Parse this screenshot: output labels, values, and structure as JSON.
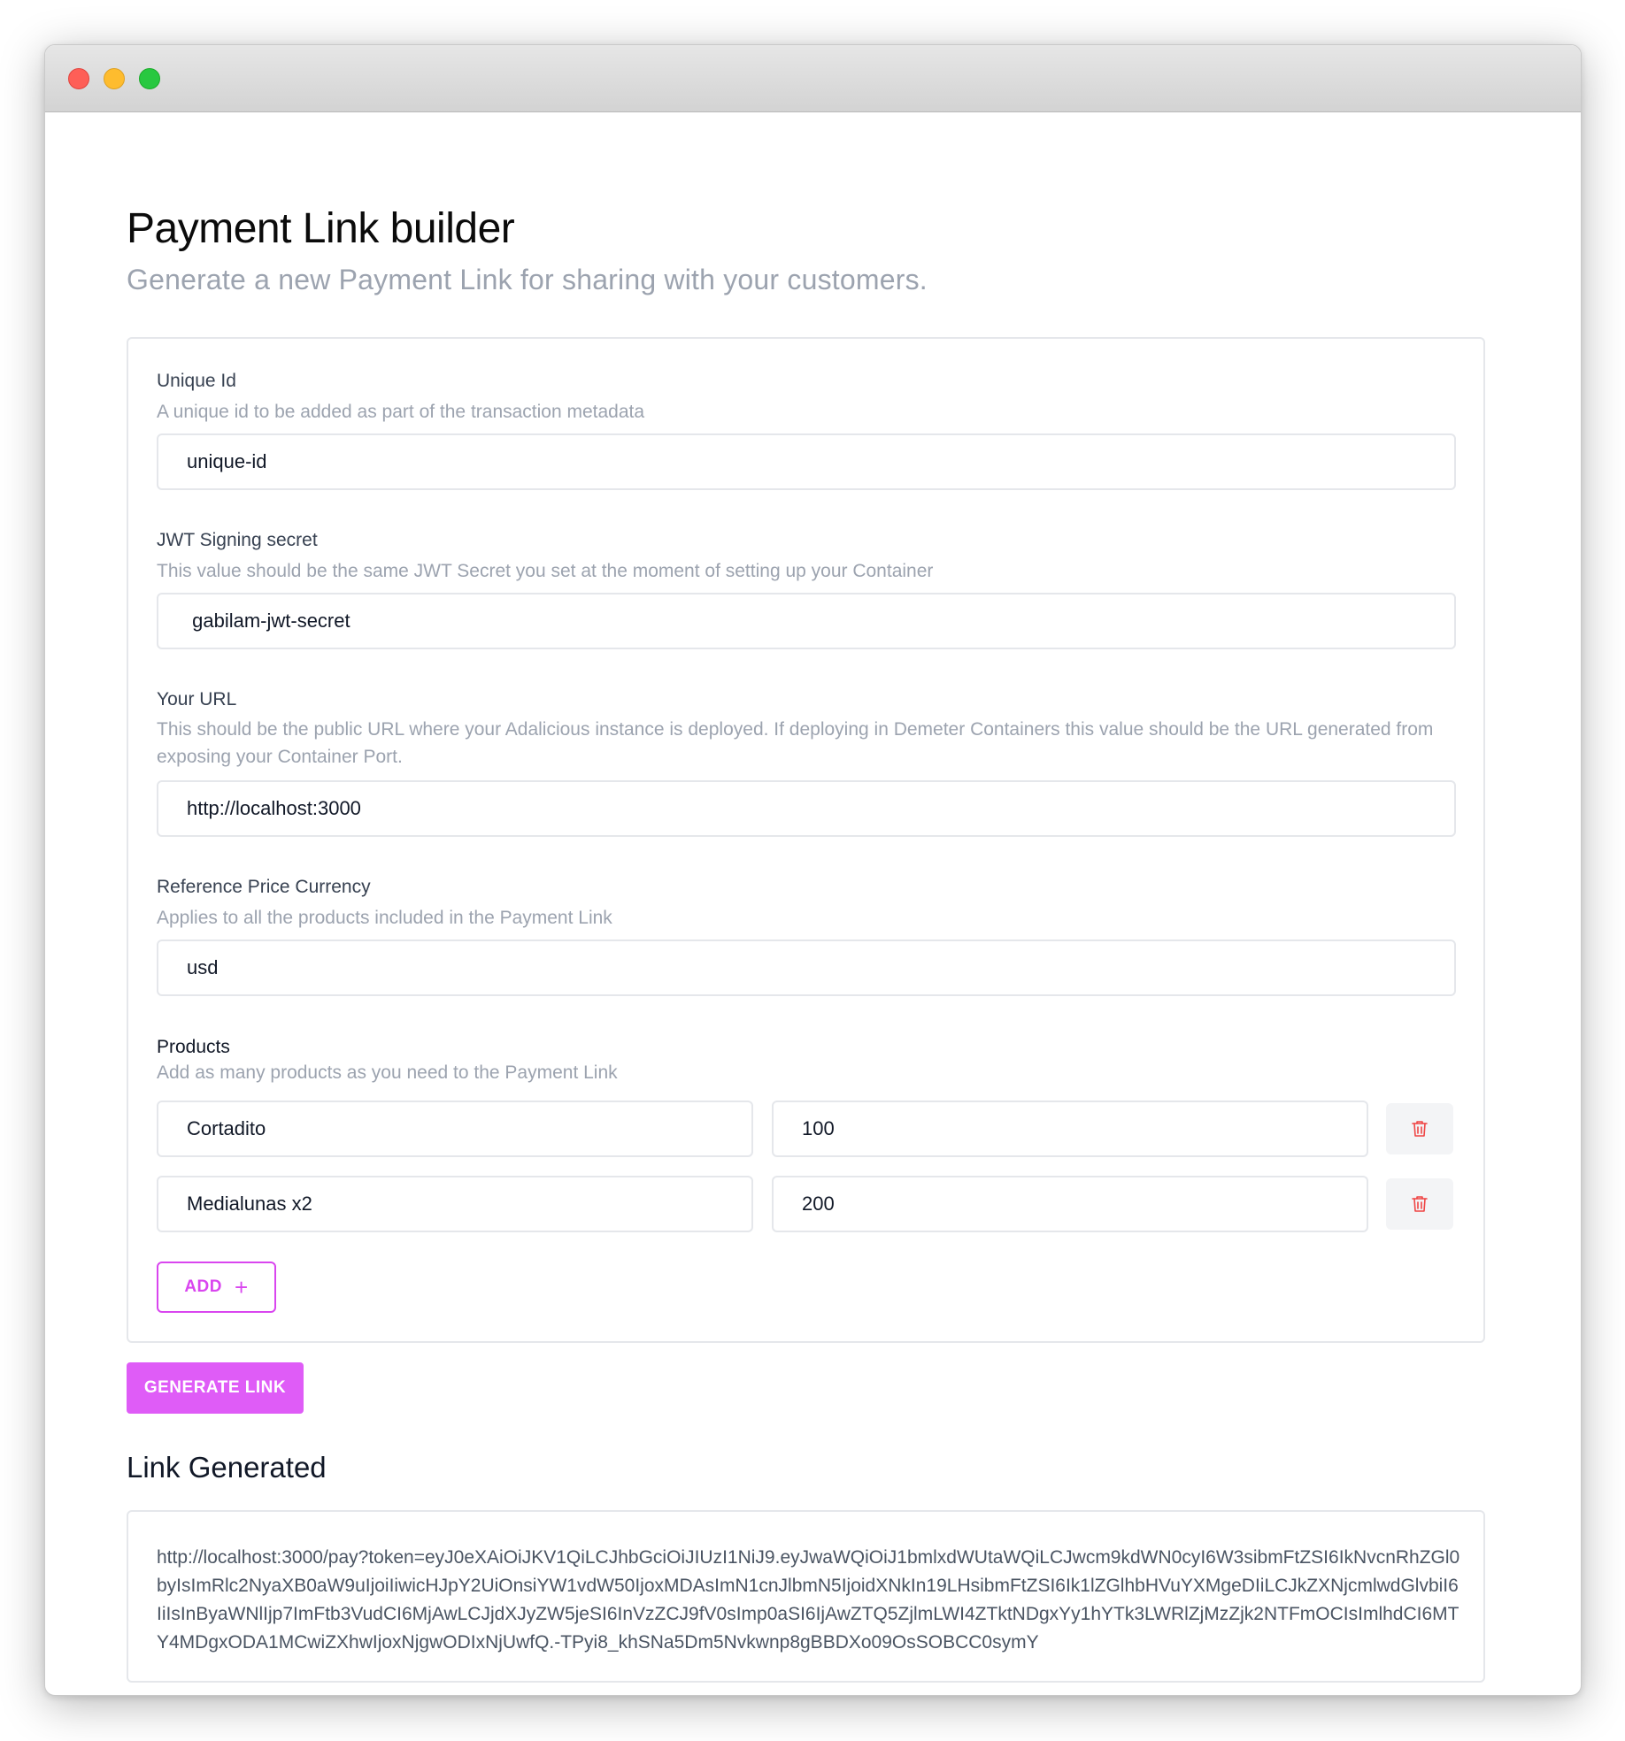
{
  "page": {
    "title": "Payment Link builder",
    "subtitle": "Generate a new Payment Link for sharing with your customers."
  },
  "fields": {
    "unique_id": {
      "label": "Unique Id",
      "help": "A unique id to be added as part of the transaction metadata",
      "value": "unique-id"
    },
    "jwt_secret": {
      "label": "JWT Signing secret",
      "help": "This value should be the same JWT Secret you set at the moment of setting up your Container",
      "value": " gabilam-jwt-secret"
    },
    "url": {
      "label": "Your URL",
      "help": "This should be the public URL where your Adalicious instance is deployed. If deploying in Demeter Containers this value should be the URL generated from exposing your Container Port.",
      "value": "http://localhost:3000"
    },
    "currency": {
      "label": "Reference Price Currency",
      "help": "Applies to all the products included in the Payment Link",
      "value": "usd"
    }
  },
  "products": {
    "label": "Products",
    "help": "Add as many products as you need to the Payment Link",
    "items": [
      {
        "name": "Cortadito",
        "price": "100"
      },
      {
        "name": "Medialunas x2",
        "price": "200"
      }
    ],
    "add_label": "ADD",
    "delete_icon": "trash-icon",
    "add_icon": "plus-icon"
  },
  "actions": {
    "generate_label": "GENERATE LINK"
  },
  "result": {
    "title": "Link Generated",
    "link": "http://localhost:3000/pay?token=eyJ0eXAiOiJKV1QiLCJhbGciOiJIUzI1NiJ9.eyJwaWQiOiJ1bmlxdWUtaWQiLCJwcm9kdWN0cyI6W3sibmFtZSI6IkNvcnRhZGl0byIsImRlc2NyaXB0aW9uIjoiIiwicHJpY2UiOnsiYW1vdW50IjoxMDAsImN1cnJlbmN5IjoidXNkIn19LHsibmFtZSI6Ik1lZGlhbHVuYXMgeDIiLCJkZXNjcmlwdGlvbiI6IiIsInByaWNlIjp7ImFtb3VudCI6MjAwLCJjdXJyZW5jeSI6InVzZCJ9fV0sImp0aSI6IjAwZTQ5ZjlmLWI4ZTktNDgxYy1hYTk3LWRlZjMzZjk2NTFmOCIsImlhdCI6MTY4MDgxODA1MCwiZXhwIjoxNjgwODIxNjUwfQ.-TPyi8_khSNa5Dm5Nvkwnp8gBBDXo09OsSOBCC0symY"
  },
  "colors": {
    "accent": "#d946ef",
    "primary_button": "#df5cf7",
    "delete_icon": "#ef4444",
    "border": "#e5e7eb",
    "muted_text": "#9ca3af"
  }
}
